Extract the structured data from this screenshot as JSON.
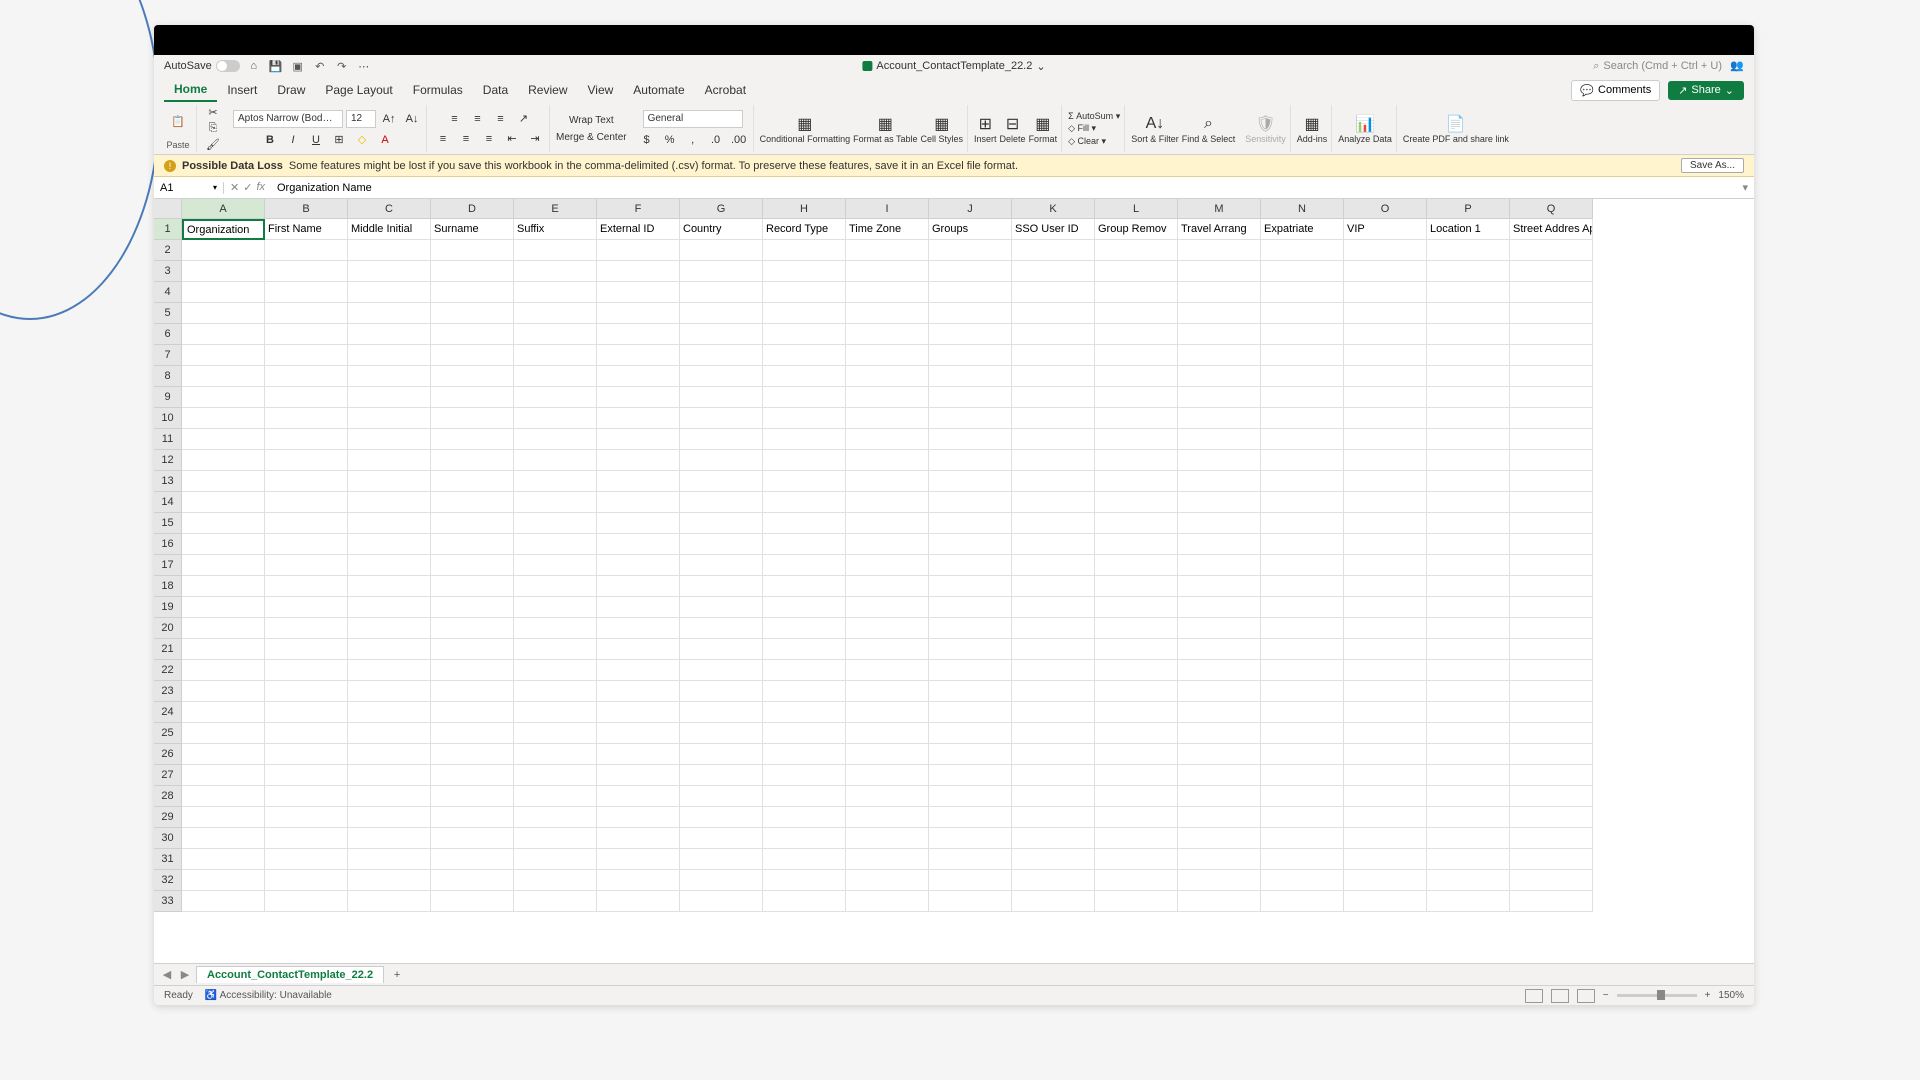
{
  "qat": {
    "autosave": "AutoSave",
    "filename": "Account_ContactTemplate_22.2",
    "search_placeholder": "Search (Cmd + Ctrl + U)"
  },
  "tabs": [
    "Home",
    "Insert",
    "Draw",
    "Page Layout",
    "Formulas",
    "Data",
    "Review",
    "View",
    "Automate",
    "Acrobat"
  ],
  "tabs_right": {
    "comments": "Comments",
    "share": "Share"
  },
  "ribbon": {
    "paste": "Paste",
    "font_name": "Aptos Narrow (Bod…",
    "font_size": "12",
    "wrap": "Wrap Text",
    "merge": "Merge & Center",
    "number_format": "General",
    "cond_fmt": "Conditional\nFormatting",
    "fmt_table": "Format\nas Table",
    "cell_styles": "Cell\nStyles",
    "insert": "Insert",
    "delete": "Delete",
    "format": "Format",
    "autosum": "AutoSum",
    "fill": "Fill",
    "clear": "Clear",
    "sort": "Sort &\nFilter",
    "find": "Find &\nSelect",
    "sensitivity": "Sensitivity",
    "addins": "Add-ins",
    "analyze": "Analyze\nData",
    "pdf": "Create PDF\nand share link"
  },
  "warning": {
    "title": "Possible Data Loss",
    "msg": "Some features might be lost if you save this workbook in the comma-delimited (.csv) format. To preserve these features, save it in an Excel file format.",
    "saveas": "Save As..."
  },
  "formula": {
    "cell_ref": "A1",
    "content": "Organization Name"
  },
  "columns": [
    "A",
    "B",
    "C",
    "D",
    "E",
    "F",
    "G",
    "H",
    "I",
    "J",
    "K",
    "L",
    "M",
    "N",
    "O",
    "P",
    "Q"
  ],
  "row1": [
    "Organization",
    "First Name",
    "Middle Initial",
    "Surname",
    "Suffix",
    "External ID",
    "Country",
    "Record Type",
    "Time Zone",
    "Groups",
    "SSO User ID",
    "Group Remov",
    "Travel Arrang",
    "Expatriate",
    "VIP",
    "Location 1",
    "Street Addres Apt"
  ],
  "row_count": 33,
  "sheet_tab": "Account_ContactTemplate_22.2",
  "status": {
    "ready": "Ready",
    "accessibility": "Accessibility: Unavailable",
    "zoom": "150%"
  }
}
